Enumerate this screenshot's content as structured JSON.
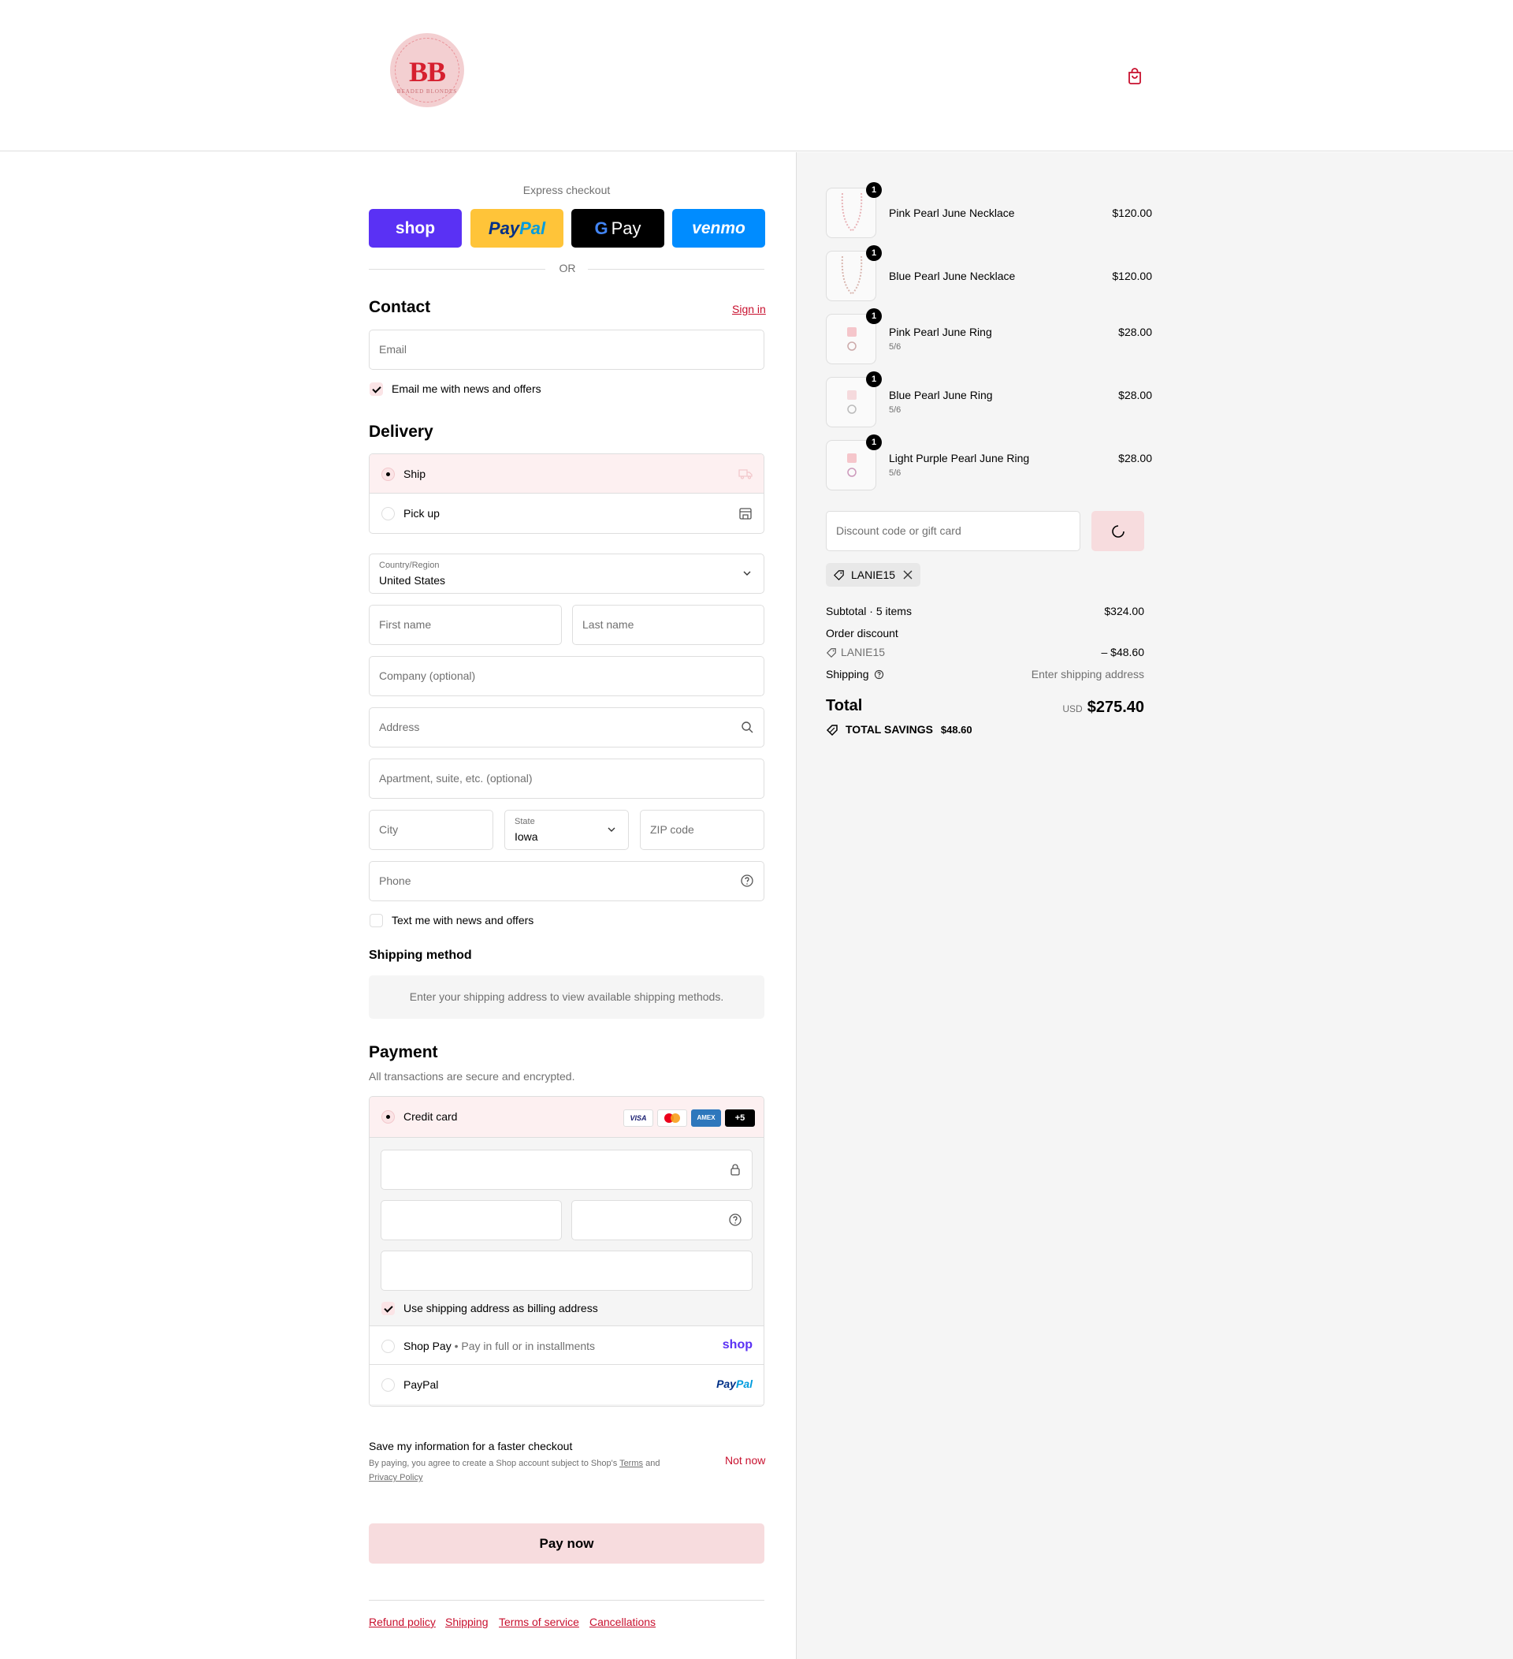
{
  "header": {
    "logo_text": "BB",
    "logo_subtext": "BEADED BLONDES",
    "cart_icon": "shopping-bag-icon"
  },
  "express": {
    "title": "Express checkout",
    "shop_label": "shop",
    "paypal_label_pay": "Pay",
    "paypal_label_pal": "Pal",
    "gpay_label": "Pay",
    "venmo_label": "venmo",
    "or_label": "OR"
  },
  "contact": {
    "heading": "Contact",
    "sign_in": "Sign in",
    "email_placeholder": "Email",
    "news_label": "Email me with news and offers",
    "news_checked": true
  },
  "delivery": {
    "heading": "Delivery",
    "options": [
      {
        "label": "Ship",
        "selected": true,
        "icon": "truck-icon"
      },
      {
        "label": "Pick up",
        "selected": false,
        "icon": "store-icon"
      }
    ],
    "country_label": "Country/Region",
    "country_value": "United States",
    "first_name_placeholder": "First name",
    "last_name_placeholder": "Last name",
    "company_placeholder": "Company (optional)",
    "address_placeholder": "Address",
    "apartment_placeholder": "Apartment, suite, etc. (optional)",
    "city_placeholder": "City",
    "state_label": "State",
    "state_value": "Iowa",
    "zip_placeholder": "ZIP code",
    "phone_placeholder": "Phone",
    "text_label": "Text me with news and offers",
    "text_checked": false
  },
  "shipping_method": {
    "heading": "Shipping method",
    "message": "Enter your shipping address to view available shipping methods."
  },
  "payment": {
    "heading": "Payment",
    "subheading": "All transactions are secure and encrypted.",
    "credit_card_label": "Credit card",
    "card_brands": [
      "VISA",
      "Mastercard",
      "AMEX",
      "+5"
    ],
    "billing_label": "Use shipping address as billing address",
    "billing_checked": true,
    "shop_pay_label": "Shop Pay",
    "shop_pay_sub": "Pay in full or in installments",
    "shop_pay_logo": "shop",
    "paypal_label": "PayPal",
    "paypal_logo_pay": "Pay",
    "paypal_logo_pal": "Pal"
  },
  "save_info": {
    "title": "Save my information for a faster checkout",
    "legal_prefix": "By paying, you agree to create a Shop account subject to Shop's",
    "terms_link": "Terms",
    "and": "and",
    "privacy_link": "Privacy Policy",
    "not_now": "Not now"
  },
  "pay_now": "Pay now",
  "footer_links": [
    "Refund policy",
    "Shipping",
    "Terms of service",
    "Cancellations"
  ],
  "order": {
    "items": [
      {
        "name": "Pink Pearl June Necklace",
        "variant": "",
        "price": "$120.00",
        "qty": "1"
      },
      {
        "name": "Blue Pearl June Necklace",
        "variant": "",
        "price": "$120.00",
        "qty": "1"
      },
      {
        "name": "Pink Pearl June Ring",
        "variant": "5/6",
        "price": "$28.00",
        "qty": "1"
      },
      {
        "name": "Blue Pearl June Ring",
        "variant": "5/6",
        "price": "$28.00",
        "qty": "1"
      },
      {
        "name": "Light Purple Pearl June Ring",
        "variant": "5/6",
        "price": "$28.00",
        "qty": "1"
      }
    ],
    "discount_placeholder": "Discount code or gift card",
    "applied_code": "LANIE15",
    "subtotal_label": "Subtotal · 5 items",
    "subtotal_value": "$324.00",
    "order_discount_label": "Order discount",
    "discount_code": "LANIE15",
    "discount_value": "– $48.60",
    "shipping_label": "Shipping",
    "shipping_value": "Enter shipping address",
    "total_label": "Total",
    "currency": "USD",
    "total_value": "$275.40",
    "savings_label": "TOTAL SAVINGS",
    "savings_value": "$48.60"
  },
  "colors": {
    "accent_red": "#c8102e",
    "pink_bg": "#fbe4e6",
    "shop_purple": "#5a31f4",
    "paypal_yellow": "#ffc439",
    "venmo_blue": "#008cff"
  }
}
